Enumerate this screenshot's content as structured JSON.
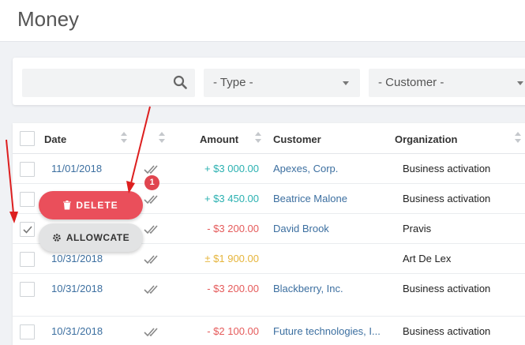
{
  "page": {
    "title": "Money"
  },
  "filters": {
    "search_value": "",
    "type_label": "- Type -",
    "customer_label": "- Customer -"
  },
  "table": {
    "headers": {
      "date": "Date",
      "amount": "Amount",
      "customer": "Customer",
      "organization": "Organization"
    },
    "rows": [
      {
        "date": "11/01/2018",
        "amount": "+ $3 000.00",
        "customer": "Apexes, Corp.",
        "organization": "Business activation",
        "checked": false
      },
      {
        "date": "",
        "amount": "+ $3 450.00",
        "customer": "Beatrice Malone",
        "organization": "Business activation",
        "checked": false
      },
      {
        "date": "",
        "amount": "- $3 200.00",
        "customer": "David Brook",
        "organization": "Pravis",
        "checked": true
      },
      {
        "date": "10/31/2018",
        "amount": "± $1 900.00",
        "customer": "",
        "organization": "Art De Lex",
        "checked": false
      },
      {
        "date": "10/31/2018",
        "amount": "- $3 200.00",
        "customer": "Blackberry, Inc.",
        "organization": "Business activation",
        "checked": false
      },
      {
        "date": "10/31/2018",
        "amount": "- $2 100.00",
        "customer": "Future technologies, I...",
        "organization": "Business activation",
        "checked": false
      }
    ]
  },
  "actions": {
    "delete_label": "DELETE",
    "allowcate_label": "ALLOWCATE",
    "badge_count": "1"
  },
  "colors": {
    "delete": "#ea4f5b",
    "positive": "#2bb1b1",
    "negative": "#e55b5b",
    "neutral": "#e6b53c",
    "link": "#3c6fa0",
    "arrow": "#dd1f1f"
  }
}
